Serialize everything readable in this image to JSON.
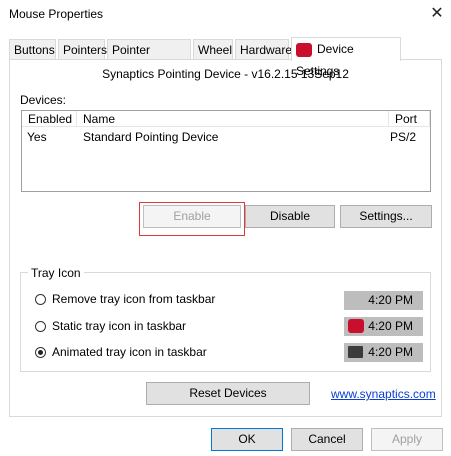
{
  "window": {
    "title": "Mouse Properties",
    "close_glyph": "✕"
  },
  "tabs": [
    {
      "label": "Buttons"
    },
    {
      "label": "Pointers"
    },
    {
      "label": "Pointer Options"
    },
    {
      "label": "Wheel"
    },
    {
      "label": "Hardware"
    },
    {
      "label": "Device Settings",
      "icon": "synaptics-icon"
    }
  ],
  "device_settings": {
    "header": "Synaptics Pointing Device - v16.2.15 13Sep12",
    "devices_label": "Devices:",
    "columns": [
      "Enabled",
      "Name",
      "Port"
    ],
    "rows": [
      {
        "enabled": "Yes",
        "name": "Standard Pointing Device",
        "port": "PS/2"
      }
    ],
    "buttons": {
      "enable": "Enable",
      "disable": "Disable",
      "settings": "Settings..."
    }
  },
  "tray_icon": {
    "label": "Tray Icon",
    "options": [
      {
        "label": "Remove tray icon from taskbar",
        "selected": false,
        "time": "4:20 PM",
        "icon": null
      },
      {
        "label": "Static tray icon in taskbar",
        "selected": false,
        "time": "4:20 PM",
        "icon": "synaptics-icon"
      },
      {
        "label": "Animated tray icon in taskbar",
        "selected": true,
        "time": "4:20 PM",
        "icon": "touchpad-icon"
      }
    ]
  },
  "reset_button": "Reset Devices",
  "link": "www.synaptics.com",
  "dialog_buttons": {
    "ok": "OK",
    "cancel": "Cancel",
    "apply": "Apply"
  },
  "colors": {
    "accent": "#0078d7",
    "synaptics_red": "#c8102e",
    "link": "#0a3dd1"
  }
}
